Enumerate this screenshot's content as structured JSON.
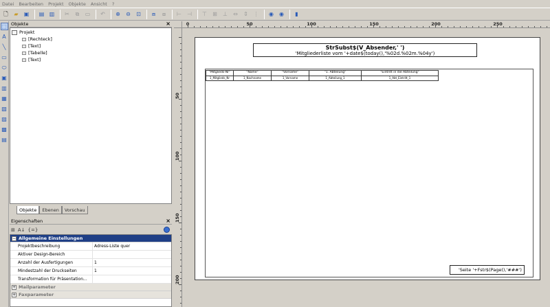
{
  "menubar": [
    "Datei",
    "Bearbeiten",
    "Projekt",
    "Objekte",
    "Ansicht",
    "?"
  ],
  "objects_panel": {
    "title": "Objekte",
    "tree": {
      "root": "Projekt",
      "children": [
        "[Rechteck]",
        "[Text]",
        "[Tabelle]",
        "[Text]"
      ]
    }
  },
  "tabs": [
    "Objekte",
    "Ebenen",
    "Vorschau"
  ],
  "properties_panel": {
    "title": "Eigenschaften",
    "toolbar": [
      "⊞",
      "A↓",
      "{=}"
    ],
    "category_general": "Allgemeine Einstellungen",
    "rows": [
      {
        "key": "Projektbeschreibung",
        "value": "Adress-Liste quer"
      },
      {
        "key": "Aktiver Design-Bereich",
        "value": ""
      },
      {
        "key": "Anzahl der Ausfertigungen",
        "value": "1"
      },
      {
        "key": "Mindestzahl der Druckseiten",
        "value": "1"
      },
      {
        "key": "Transformation für Präsentation...",
        "value": ""
      }
    ],
    "category_mail": "Mailparameter",
    "category_fax": "Faxparameter"
  },
  "ruler": {
    "top_labels": [
      "0",
      "50",
      "100",
      "150",
      "200",
      "250"
    ],
    "left_labels": [
      "50",
      "100",
      "150",
      "200"
    ]
  },
  "report": {
    "header_line1": "StrSubst$(V_Absender,' ')",
    "header_line2": "'Mitgliederliste vom '+date$(today(),'%02d.%02m.%04y')",
    "columns": [
      {
        "head": "\"Mitglieds-Nr\"",
        "data": "1_Mitglieds_Nr"
      },
      {
        "head": "\"Name\"",
        "data": "1_Nachname"
      },
      {
        "head": "\"Vorname\"",
        "data": "1_Vorname"
      },
      {
        "head": "\"1. Abteilung\"",
        "data": "1_Abteilung_1"
      },
      {
        "head": "\"Eintritt in die Abteilung\"",
        "data": "1_Abt_Eintritt_1"
      }
    ],
    "footer": "'Seite '+Fstr$(Page(),'###')"
  }
}
